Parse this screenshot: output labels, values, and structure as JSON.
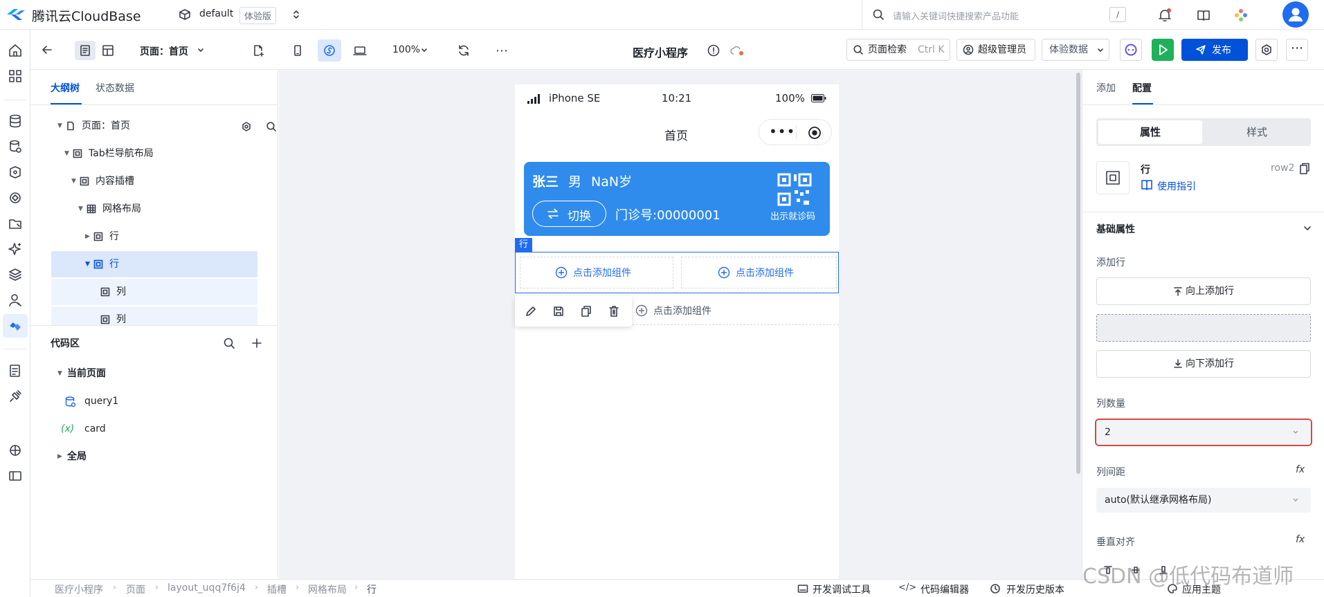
{
  "topbar": {
    "brand": "腾讯云CloudBase",
    "env_name": "default",
    "env_badge": "体验版",
    "search_placeholder": "请输入关键词快捷搜索产品功能",
    "search_shortcut": "/"
  },
  "toolbar": {
    "page_label": "页面：首页",
    "zoom": "100%",
    "app_title": "医疗小程序",
    "page_search": "页面检索",
    "page_search_shortcut": "Ctrl K",
    "admin": "超级管理员",
    "data_mode": "体验数据",
    "publish": "发布"
  },
  "outline": {
    "tabs": [
      "大纲树",
      "状态数据"
    ],
    "tree": [
      {
        "label": "页面：首页"
      },
      {
        "label": "Tab栏导航布局"
      },
      {
        "label": "内容插槽"
      },
      {
        "label": "网格布局"
      },
      {
        "label": "行"
      },
      {
        "label": "行"
      },
      {
        "label": "列"
      },
      {
        "label": "列"
      }
    ]
  },
  "code": {
    "title": "代码区",
    "current_page": "当前页面",
    "items": [
      {
        "label": "query1"
      },
      {
        "label": "card"
      }
    ],
    "global": "全局"
  },
  "phone": {
    "carrier": "iPhone SE",
    "time": "10:21",
    "battery": "100%",
    "nav_title": "首页",
    "card": {
      "name": "张三",
      "gender": "男",
      "age": "NaN岁",
      "switch": "切换",
      "clinic_no": "门诊号:00000001",
      "qr_caption": "出示就诊码"
    },
    "row_tag": "行",
    "add_component": "点击添加组件"
  },
  "config": {
    "tabs": [
      "添加",
      "配置"
    ],
    "seg_props": "属性",
    "seg_style": "样式",
    "component_name": "行",
    "component_id": "row2",
    "guide_link": "使用指引",
    "section": "基础属性",
    "add_row_label": "添加行",
    "add_row_above": "向上添加行",
    "add_row_below": "向下添加行",
    "col_count_label": "列数量",
    "col_count_value": "2",
    "col_gap_label": "列间距",
    "col_gap_value": "auto(默认继承网格布局)",
    "valign_label": "垂直对齐",
    "fx": "fx"
  },
  "bottom": {
    "breadcrumb": [
      "医疗小程序",
      "页面",
      "layout_uqq7f6j4",
      "插槽",
      "网格布局",
      "行"
    ],
    "debug_tools": "开发调试工具",
    "code_editor": "代码编辑器",
    "history": "开发历史版本",
    "apply_theme": "应用主题",
    "watermark": "CSDN @低代码布道师"
  },
  "colors": {
    "primary": "#0052d9",
    "green": "#1fb15a",
    "card_blue": "#2f8cec",
    "select_border": "#d54941"
  }
}
